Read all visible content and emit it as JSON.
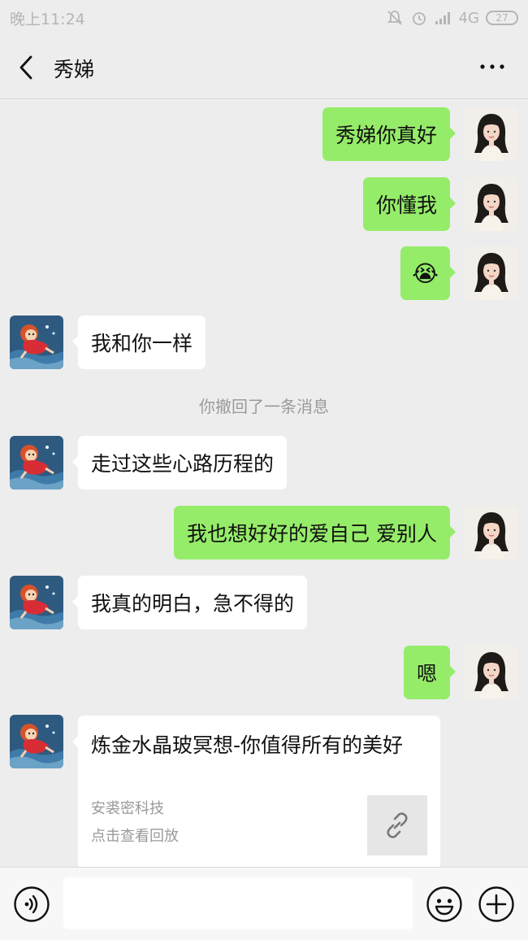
{
  "status_bar": {
    "time": "晚上11:24",
    "network": "4G",
    "battery": "27"
  },
  "header": {
    "title": "秀娣"
  },
  "messages": {
    "m1": "秀娣你真好",
    "m2": "你懂我",
    "m3_emoji": "😭",
    "m4": "我和你一样",
    "notice": "你撤回了一条消息",
    "m5": "走过这些心路历程的",
    "m6": "我也想好好的爱自己 爱别人",
    "m7": "我真的明白，急不得的",
    "m8": "嗯"
  },
  "card": {
    "title": "炼金水晶玻冥想-你值得所有的美好",
    "source": "安裘密科技",
    "subtitle": "点击查看回放"
  },
  "input": {
    "value": ""
  },
  "colors": {
    "outgoing_bubble": "#95ec69",
    "incoming_bubble": "#ffffff",
    "background": "#ededed"
  }
}
